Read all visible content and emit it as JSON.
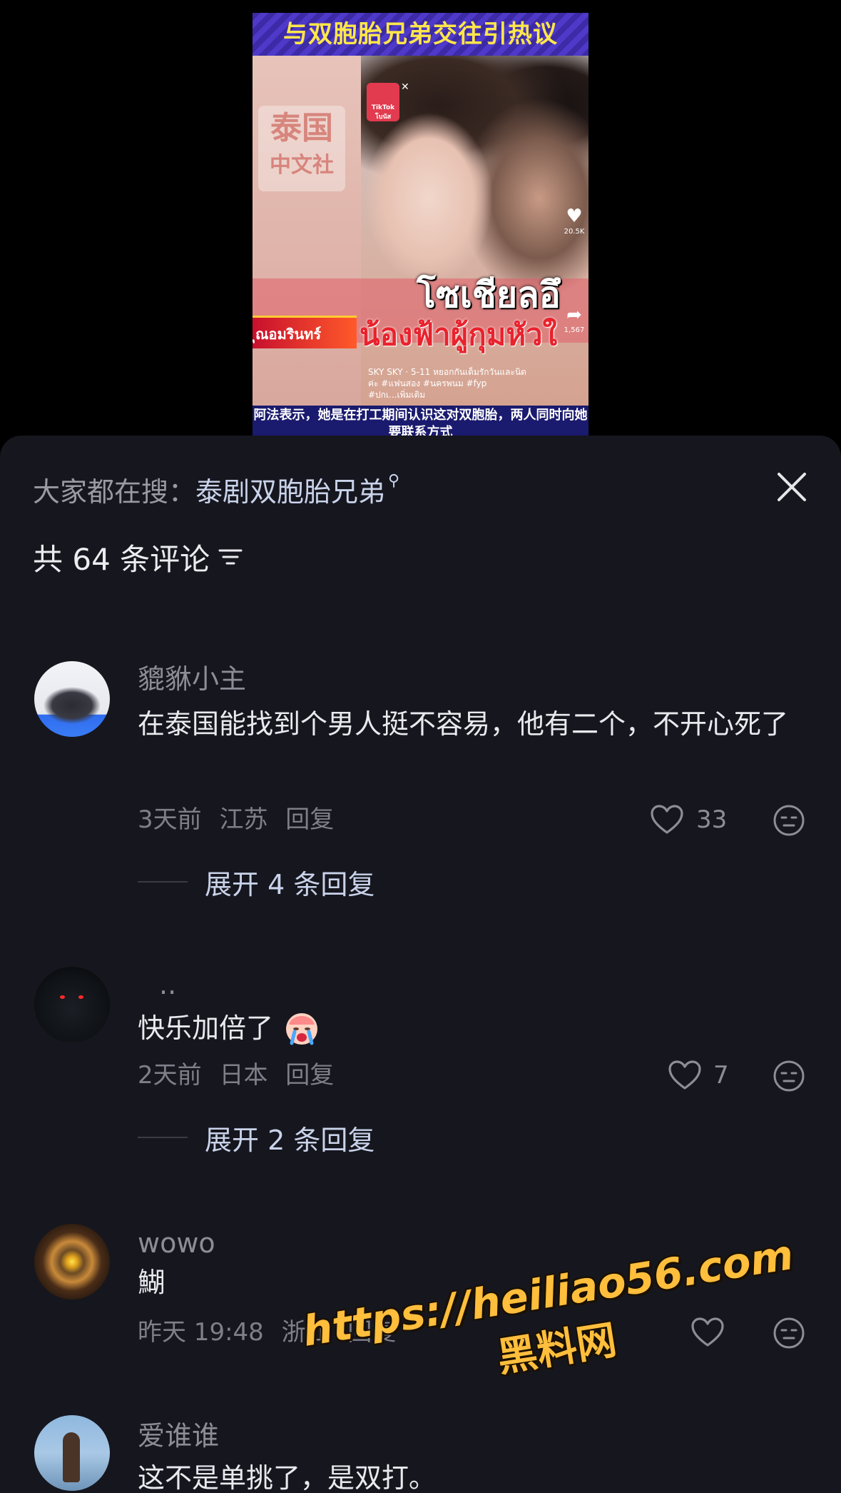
{
  "video": {
    "banner_title": "与双胞胎兄弟交往引热议",
    "watermark_line1": "泰国",
    "watermark_line2": "中文社",
    "gift_badge": "TikTok โบนัส",
    "thai_headline_1": "โซเชียลอึ",
    "thai_headline_2": "น้องฟ้าผู้กุมหัวใ",
    "name_tag": "ุณอมรินทร์",
    "hashtags": "SKY SKY · 5-11 หยอกกันเต็มรักวันและนิดค่ะ #แฟนสอง #นครพนม #fyp #ปกเ...เพิ่มเติม",
    "like_count": "20.5K",
    "share_count": "1,567",
    "caption": "阿法表示，她是在打工期间认识这对双胞胎，两人同时向她要联系方式"
  },
  "sheet": {
    "search_label": "大家都在搜：",
    "search_term": "泰剧双胞胎兄弟",
    "comment_count": "共 64 条评论"
  },
  "comments": [
    {
      "name": "貔貅小主",
      "text": "在泰国能找到个男人挺不容易，他有二个，不开心死了",
      "time": "3天前",
      "location": "江苏",
      "reply_label": "回复",
      "likes": "33",
      "expand": "展开 4 条回复"
    },
    {
      "name": "..",
      "text": "快乐加倍了",
      "time": "2天前",
      "location": "日本",
      "reply_label": "回复",
      "likes": "7",
      "expand": "展开 2 条回复"
    },
    {
      "name": "wowo",
      "text": "鰗",
      "time": "昨天 19:48",
      "location": "浙江",
      "reply_label": "回复",
      "likes": ""
    },
    {
      "name": "爱谁谁",
      "text": "这不是单挑了，是双打。"
    }
  ],
  "watermark": {
    "url": "https://heiliao56.com",
    "name": "黑料网"
  },
  "colors": {
    "sheet_bg": "#16161e",
    "accent_text": "#c9d3ea",
    "watermark": "#ffbe3c"
  }
}
